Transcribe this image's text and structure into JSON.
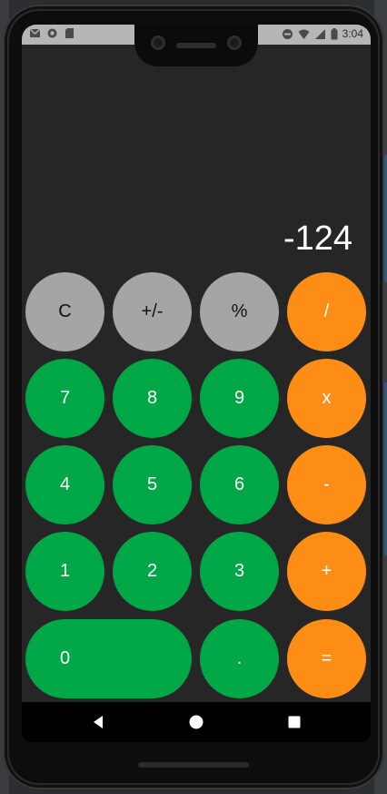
{
  "status_bar": {
    "time": "3:04",
    "left_icons": [
      "gmail-icon",
      "record-icon",
      "sd-card-icon"
    ],
    "right_icons": [
      "do-not-disturb-icon",
      "wifi-icon",
      "cell-signal-icon",
      "battery-icon"
    ]
  },
  "display": {
    "value": "-124"
  },
  "keys": {
    "clear": "C",
    "sign": "+/-",
    "percent": "%",
    "divide": "/",
    "seven": "7",
    "eight": "8",
    "nine": "9",
    "multiply": "x",
    "four": "4",
    "five": "5",
    "six": "6",
    "subtract": "-",
    "one": "1",
    "two": "2",
    "three": "3",
    "add": "+",
    "zero": "0",
    "decimal": ".",
    "equals": "="
  },
  "colors": {
    "function_key": "#a5a5a5",
    "number_key": "#00a746",
    "operator_key": "#fe8d16",
    "screen_background": "#262626"
  },
  "nav_bar": {
    "icons": [
      "back-icon",
      "home-icon",
      "recents-icon"
    ]
  }
}
